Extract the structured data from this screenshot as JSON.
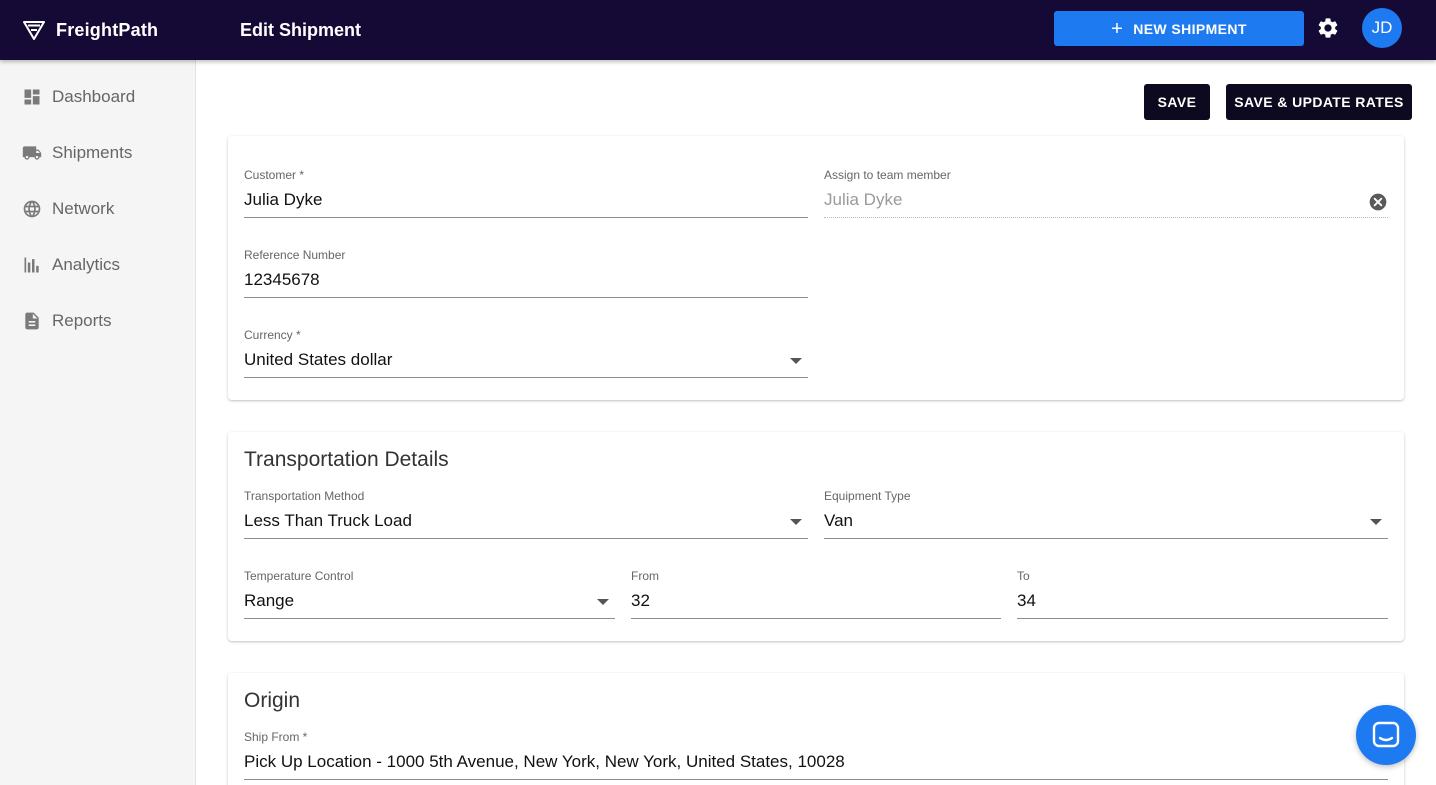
{
  "app": {
    "brand": "FreightPath",
    "page_title": "Edit Shipment"
  },
  "header": {
    "new_shipment_label": "NEW SHIPMENT",
    "avatar_initials": "JD"
  },
  "sidebar": {
    "items": [
      {
        "label": "Dashboard",
        "icon": "dashboard-icon"
      },
      {
        "label": "Shipments",
        "icon": "truck-icon"
      },
      {
        "label": "Network",
        "icon": "globe-icon"
      },
      {
        "label": "Analytics",
        "icon": "bar-chart-icon"
      },
      {
        "label": "Reports",
        "icon": "document-icon"
      }
    ]
  },
  "actions": {
    "save_label": "SAVE",
    "save_update_label": "SAVE & UPDATE RATES"
  },
  "general": {
    "customer": {
      "label": "Customer *",
      "value": "Julia Dyke"
    },
    "assign": {
      "label": "Assign to team member",
      "value": "Julia Dyke"
    },
    "reference": {
      "label": "Reference Number",
      "value": "12345678"
    },
    "currency": {
      "label": "Currency *",
      "value": "United States dollar"
    }
  },
  "transport": {
    "title": "Transportation Details",
    "method": {
      "label": "Transportation Method",
      "value": "Less Than Truck Load"
    },
    "equipment": {
      "label": "Equipment Type",
      "value": "Van"
    },
    "temperature": {
      "label": "Temperature Control",
      "value": "Range"
    },
    "from": {
      "label": "From",
      "value": "32"
    },
    "to": {
      "label": "To",
      "value": "34"
    }
  },
  "origin": {
    "title": "Origin",
    "ship_from": {
      "label": "Ship From *",
      "value": "Pick Up Location - 1000 5th Avenue, New York, New York, United States, 10028"
    }
  },
  "colors": {
    "appbar": "#150a36",
    "accent": "#1e7af0",
    "dark_button": "#0d0a1f"
  }
}
